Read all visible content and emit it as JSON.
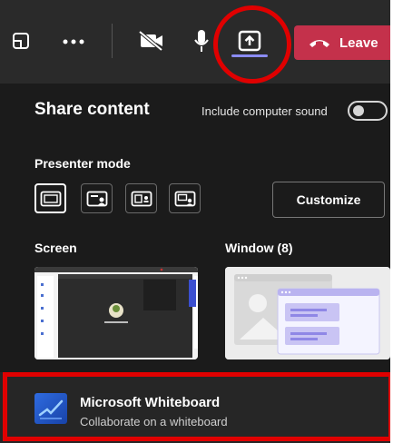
{
  "toolbar": {
    "icons": {
      "popout": "popout-icon",
      "more": "more-dots-icon",
      "camera": "camera-off-icon",
      "mic": "microphone-icon",
      "share": "share-screen-icon",
      "phone": "hang-up-icon"
    },
    "leave_label": "Leave",
    "colors": {
      "leave": "#c4314b",
      "active_indicator": "#8b8cf5"
    }
  },
  "share": {
    "title": "Share content",
    "include_sound_label": "Include computer sound",
    "include_sound_on": false,
    "presenter_mode_label": "Presenter mode",
    "presenter_modes": [
      "content-only-icon",
      "standout-icon",
      "side-by-side-icon",
      "reporter-icon"
    ],
    "customize_label": "Customize",
    "screen_label": "Screen",
    "window_label": "Window (8)"
  },
  "whiteboard": {
    "title": "Microsoft Whiteboard",
    "subtitle": "Collaborate on a whiteboard",
    "icon": "whiteboard-app-icon"
  },
  "annotations": {
    "highlight_color": "#e00000"
  }
}
